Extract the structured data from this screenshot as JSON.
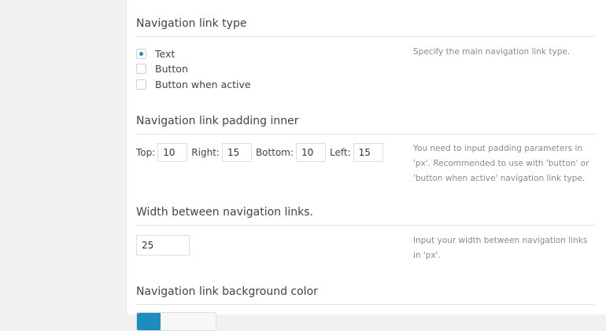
{
  "sections": {
    "link_type": {
      "title": "Navigation link type",
      "description": "Specify the main navigation link type.",
      "options": [
        {
          "label": "Text",
          "checked": true
        },
        {
          "label": "Button",
          "checked": false
        },
        {
          "label": "Button when active",
          "checked": false
        }
      ]
    },
    "padding": {
      "title": "Navigation link padding inner",
      "description": "You need to input padding parameters in 'px'. Recommended to use with 'button' or 'button when active' navigation link type.",
      "top_label": "Top:",
      "top_value": "10",
      "right_label": "Right:",
      "right_value": "15",
      "bottom_label": "Bottom:",
      "bottom_value": "10",
      "left_label": "Left:",
      "left_value": "15"
    },
    "width": {
      "title": "Width between navigation links.",
      "description": "Input your width between navigation links in 'px'.",
      "value": "25"
    },
    "background": {
      "title": "Navigation link background color",
      "swatch_color": "#1e8cbe"
    }
  }
}
